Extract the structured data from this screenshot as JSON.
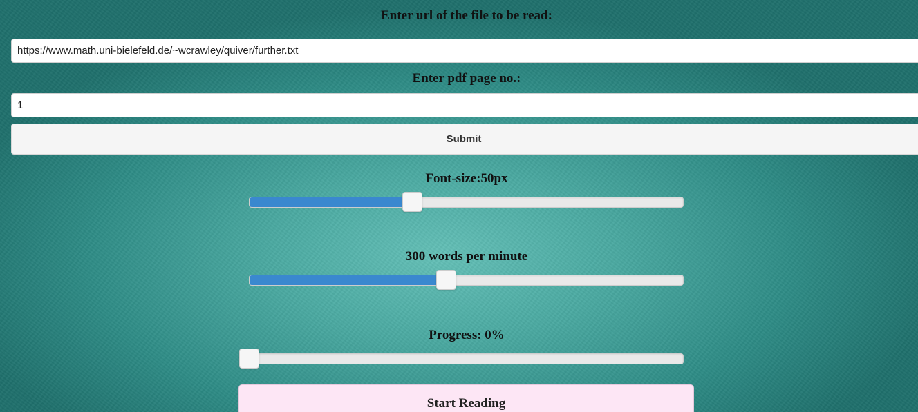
{
  "url_section": {
    "label": "Enter url of the file to be read:",
    "value": "https://www.math.uni-bielefeld.de/~wcrawley/quiver/further.txt"
  },
  "page_section": {
    "label": "Enter pdf page no.:",
    "value": "1"
  },
  "submit_label": "Submit",
  "font_size": {
    "label": "Font-size:50px",
    "level": 0.376
  },
  "speed": {
    "label": "300 words per minute",
    "level": 0.455
  },
  "progress": {
    "label": "Progress: 0%",
    "level": 0
  },
  "start_label": "Start Reading",
  "colors": {
    "slider_fill": "#3a88cf",
    "start_button_bg": "#fde6f5",
    "background": "#4aa9a1"
  }
}
